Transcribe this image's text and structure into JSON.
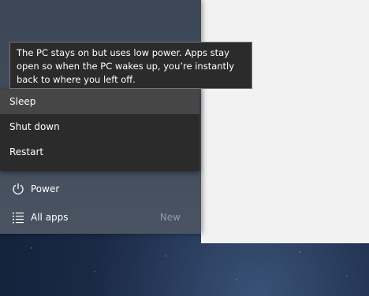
{
  "tooltip": {
    "text": "The PC stays on but uses low power. Apps stay open so when the PC wakes up, you’re instantly back to where you left off."
  },
  "power_menu": {
    "items": [
      {
        "label": "Sleep",
        "selected": true
      },
      {
        "label": "Shut down",
        "selected": false
      },
      {
        "label": "Restart",
        "selected": false
      }
    ]
  },
  "start_menu": {
    "power_label": "Power",
    "power_icon": "power-icon",
    "all_apps_label": "All apps",
    "all_apps_icon": "all-apps-list-icon",
    "new_badge": "New"
  },
  "colors": {
    "menu_bg": "#2b2b2b",
    "selected_bg": "#464646",
    "window_bg": "#f2f2f2",
    "new_badge": "#8e9aad"
  }
}
